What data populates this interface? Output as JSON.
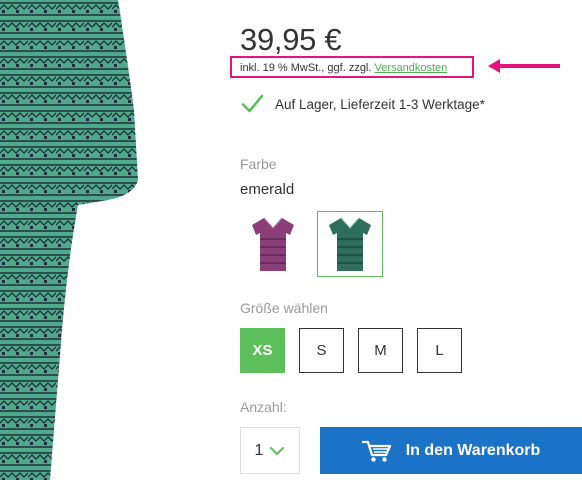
{
  "product": {
    "price": "39,95 €",
    "tax_note": "inkl. 19 % MwSt., ggf. zzgl.",
    "shipping_link": "Versandkosten",
    "stock_text": "Auf Lager, Lieferzeit 1-3 Werktage*"
  },
  "color": {
    "label": "Farbe",
    "selected_value": "emerald",
    "swatches": [
      {
        "name": "berry",
        "hex": "#8a3f78",
        "selected": false
      },
      {
        "name": "emerald",
        "hex": "#2e6e5a",
        "selected": true
      }
    ]
  },
  "size": {
    "label": "Größe wählen",
    "options": [
      "XS",
      "S",
      "M",
      "L"
    ],
    "selected": "XS"
  },
  "quantity": {
    "label": "Anzahl:",
    "value": "1"
  },
  "cart": {
    "button_label": "In den Warenkorb"
  },
  "colors": {
    "accent_green": "#5cbf5a",
    "cart_blue": "#1a73c7",
    "highlight_magenta": "#e8127f"
  },
  "icons": [
    "check-icon",
    "chevron-down-icon",
    "cart-icon",
    "arrow-left-icon"
  ]
}
